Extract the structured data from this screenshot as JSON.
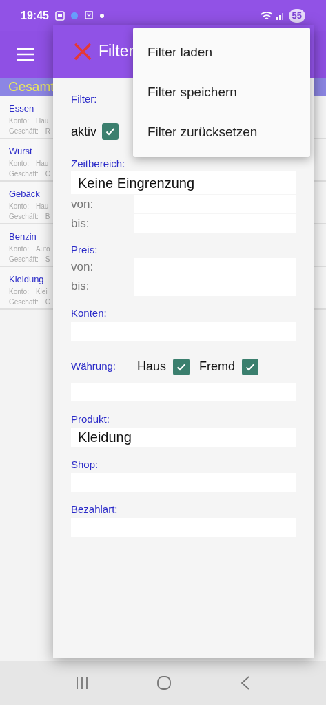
{
  "status_bar": {
    "time": "19:45",
    "battery": "55"
  },
  "list": {
    "header_left": "Gesamt",
    "items": [
      {
        "name": "Essen",
        "konto_label": "Konto:",
        "konto_value": "Hau",
        "shop_label": "Geschäft:",
        "shop_value": "R"
      },
      {
        "name": "Wurst",
        "konto_label": "Konto:",
        "konto_value": "Hau",
        "shop_label": "Geschäft:",
        "shop_value": "O"
      },
      {
        "name": "Gebäck",
        "konto_label": "Konto:",
        "konto_value": "Hau",
        "shop_label": "Geschäft:",
        "shop_value": "B"
      },
      {
        "name": "Benzin",
        "konto_label": "Konto:",
        "konto_value": "Auto",
        "shop_label": "Geschäft:",
        "shop_value": "S"
      },
      {
        "name": "Kleidung",
        "konto_label": "Konto:",
        "konto_value": "Klei",
        "shop_label": "Geschäft:",
        "shop_value": "C"
      }
    ]
  },
  "dialog": {
    "title": "Filter",
    "filter_label": "Filter:",
    "active": {
      "label": "aktiv",
      "checked": true
    },
    "zeitbereich": {
      "label": "Zeitbereich:",
      "value": "Keine Eingrenzung",
      "from_label": "von:",
      "to_label": "bis:"
    },
    "preis": {
      "label": "Preis:",
      "from_label": "von:",
      "to_label": "bis:"
    },
    "konten": {
      "label": "Konten:"
    },
    "waehrung": {
      "label": "Währung:",
      "options": [
        {
          "label": "Haus",
          "checked": true
        },
        {
          "label": "Fremd",
          "checked": true
        }
      ]
    },
    "produkt": {
      "label": "Produkt:",
      "value": "Kleidung"
    },
    "shop": {
      "label": "Shop:"
    },
    "bezahlart": {
      "label": "Bezahlart:"
    }
  },
  "menu": {
    "items": [
      "Filter laden",
      "Filter speichern",
      "Filter zurücksetzen"
    ]
  }
}
